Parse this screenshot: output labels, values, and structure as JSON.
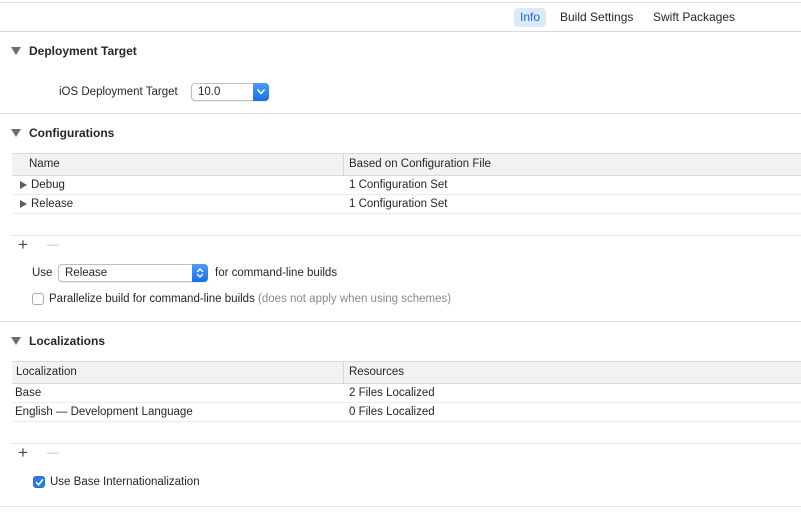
{
  "tabs": [
    {
      "label": "Info",
      "active": true
    },
    {
      "label": "Build Settings",
      "active": false
    },
    {
      "label": "Swift Packages",
      "active": false
    }
  ],
  "deployment": {
    "title": "Deployment Target",
    "field_label": "iOS Deployment Target",
    "value": "10.0"
  },
  "configurations": {
    "title": "Configurations",
    "columns": [
      "Name",
      "Based on Configuration File"
    ],
    "rows": [
      {
        "name": "Debug",
        "file": "1 Configuration Set"
      },
      {
        "name": "Release",
        "file": "1 Configuration Set"
      }
    ],
    "add": "+",
    "remove": "—",
    "use_label": "Use",
    "use_value": "Release",
    "use_suffix": "for command-line builds",
    "parallelize_label": "Parallelize build for command-line builds",
    "parallelize_note": "(does not apply when using schemes)",
    "parallelize_checked": false
  },
  "localizations": {
    "title": "Localizations",
    "columns": [
      "Localization",
      "Resources"
    ],
    "rows": [
      {
        "name": "Base",
        "resources": "2 Files Localized"
      },
      {
        "name": "English — Development Language",
        "resources": "0 Files Localized"
      }
    ],
    "add": "+",
    "remove": "—",
    "base_intl_label": "Use Base Internationalization",
    "base_intl_checked": true
  },
  "colors": {
    "accent": "#2a7de9",
    "tab_active_bg": "#dbe9fb"
  }
}
